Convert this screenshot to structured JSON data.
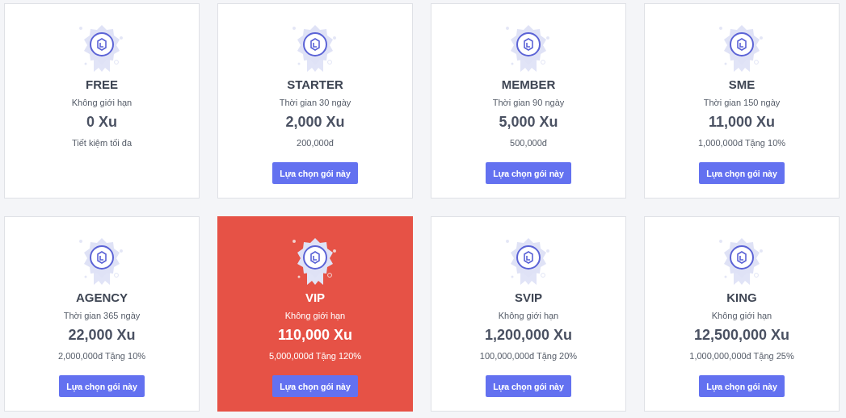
{
  "plans": [
    {
      "name": "FREE",
      "duration": "Không giới hạn",
      "price": "0 Xu",
      "note": "Tiết kiệm tối đa",
      "selected": false
    },
    {
      "name": "STARTER",
      "duration": "Thời gian 30 ngày",
      "price": "2,000 Xu",
      "note": "200,000đ",
      "button": "Lựa chọn gói này",
      "selected": false
    },
    {
      "name": "MEMBER",
      "duration": "Thời gian 90 ngày",
      "price": "5,000 Xu",
      "note": "500,000đ",
      "button": "Lựa chọn gói này",
      "selected": false
    },
    {
      "name": "SME",
      "duration": "Thời gian 150 ngày",
      "price": "11,000 Xu",
      "note": "1,000,000đ Tặng 10%",
      "button": "Lựa chọn gói này",
      "selected": false
    },
    {
      "name": "AGENCY",
      "duration": "Thời gian 365 ngày",
      "price": "22,000 Xu",
      "note": "2,000,000đ Tặng 10%",
      "button": "Lựa chọn gói này",
      "selected": false
    },
    {
      "name": "VIP",
      "duration": "Không giới hạn",
      "price": "110,000 Xu",
      "note": "5,000,000đ Tặng 120%",
      "button": "Lựa chọn gói này",
      "selected": true
    },
    {
      "name": "SVIP",
      "duration": "Không giới hạn",
      "price": "1,200,000 Xu",
      "note": "100,000,000đ Tặng 20%",
      "button": "Lựa chọn gói này",
      "selected": false
    },
    {
      "name": "KING",
      "duration": "Không giới hạn",
      "price": "12,500,000 Xu",
      "note": "1,000,000,000đ Tặng 25%",
      "button": "Lựa chọn gói này",
      "selected": false
    }
  ]
}
